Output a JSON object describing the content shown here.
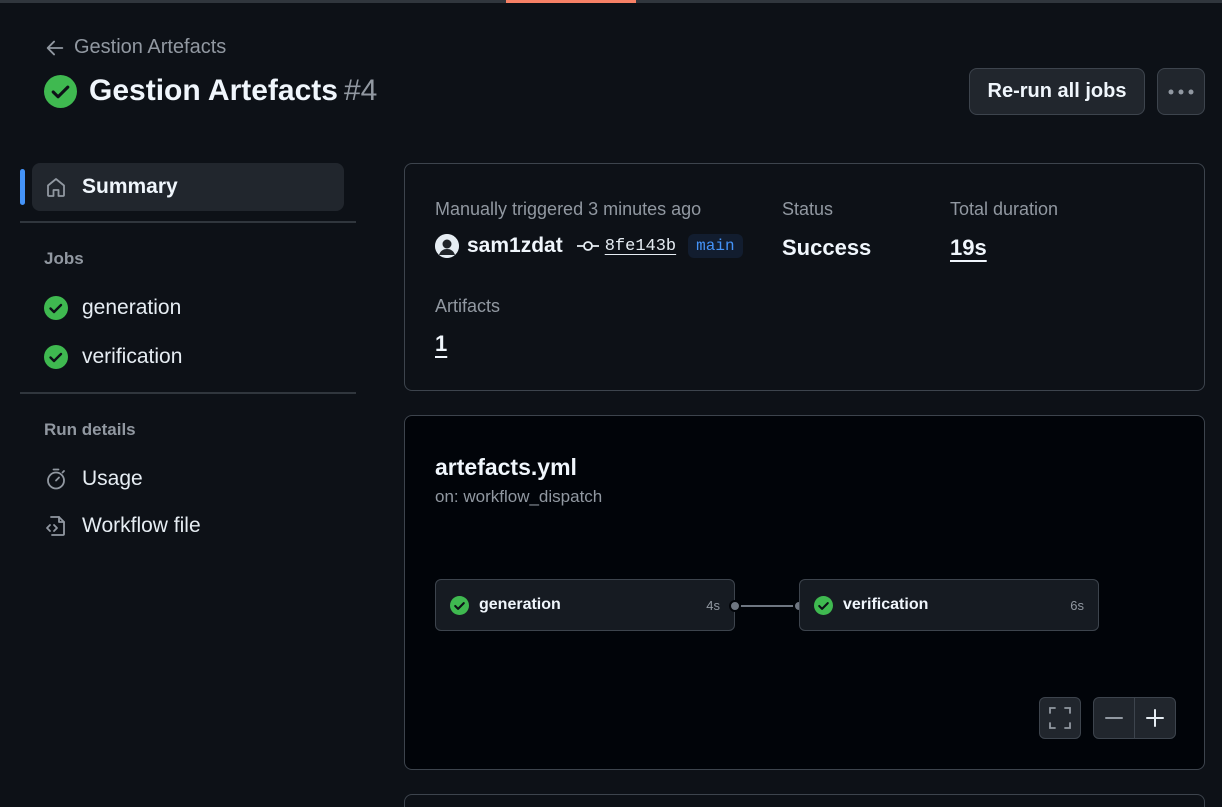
{
  "header": {
    "back_label": "Gestion Artefacts",
    "title": "Gestion Artefacts",
    "run_number": "#4",
    "rerun_label": "Re-run all jobs"
  },
  "sidebar": {
    "summary_label": "Summary",
    "jobs_heading": "Jobs",
    "jobs": [
      {
        "label": "generation",
        "status": "success"
      },
      {
        "label": "verification",
        "status": "success"
      }
    ],
    "run_details_heading": "Run details",
    "details": [
      {
        "label": "Usage",
        "icon": "stopwatch-icon"
      },
      {
        "label": "Workflow file",
        "icon": "file-code-icon"
      }
    ]
  },
  "summary": {
    "trigger_label": "Manually triggered 3 minutes ago",
    "actor": "sam1zdat",
    "commit": "8fe143b",
    "branch": "main",
    "status_label": "Status",
    "status_value": "Success",
    "duration_label": "Total duration",
    "duration_value": "19s",
    "artifacts_label": "Artifacts",
    "artifacts_value": "1"
  },
  "graph": {
    "workflow_file": "artefacts.yml",
    "trigger": "on: workflow_dispatch",
    "jobs": [
      {
        "name": "generation",
        "duration": "4s",
        "status": "success"
      },
      {
        "name": "verification",
        "duration": "6s",
        "status": "success"
      }
    ]
  },
  "colors": {
    "background": "#0d1117",
    "success": "#3fb950",
    "accent": "#4493f8",
    "border": "#3d444d"
  }
}
